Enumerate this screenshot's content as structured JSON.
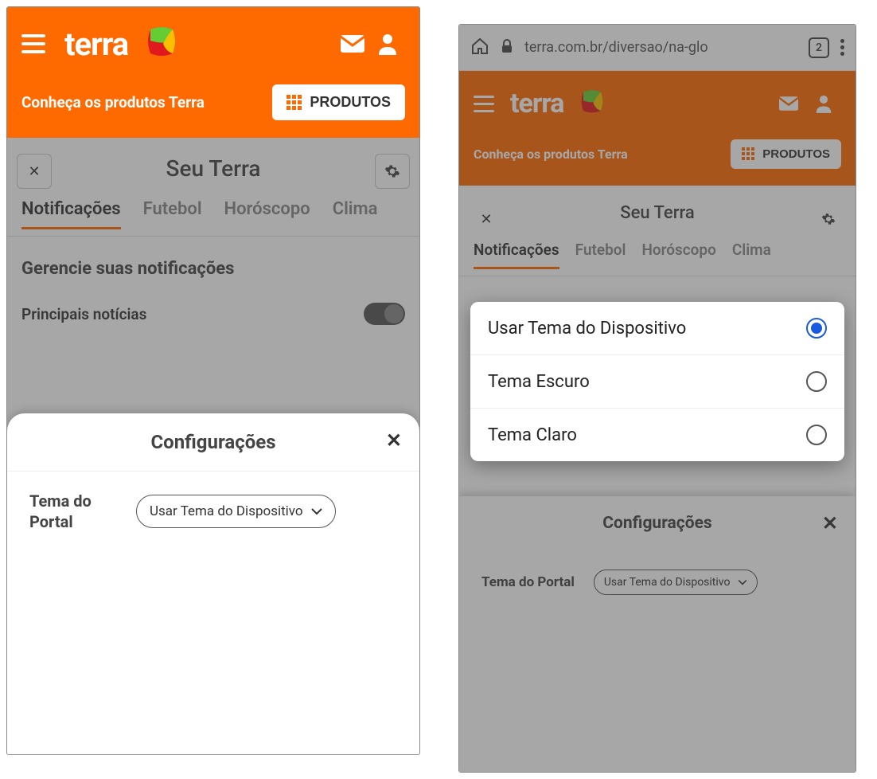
{
  "brand": "terra",
  "header_subtext": "Conheça os produtos Terra",
  "products_button": "PRODUTOS",
  "panel_title": "Seu Terra",
  "tabs": [
    "Notificações",
    "Futebol",
    "Horóscopo",
    "Clima"
  ],
  "active_tab_index": 0,
  "notifications": {
    "section_title": "Gerencie suas notificações",
    "rows": [
      {
        "label": "Principais notícias",
        "on": false
      }
    ]
  },
  "sheet": {
    "title": "Configurações",
    "field_label": "Tema do Portal",
    "field_label_multiline": "Tema do\nPortal",
    "selected_value": "Usar Tema do Dispositivo"
  },
  "theme_options": [
    {
      "label": "Usar Tema do Dispositivo",
      "selected": true
    },
    {
      "label": "Tema Escuro",
      "selected": false
    },
    {
      "label": "Tema Claro",
      "selected": false
    }
  ],
  "browser": {
    "url": "terra.com.br/diversao/na-glo",
    "tab_count": "2"
  },
  "colors": {
    "accent": "#ff6a00",
    "radio_selected": "#1a5ae0"
  }
}
